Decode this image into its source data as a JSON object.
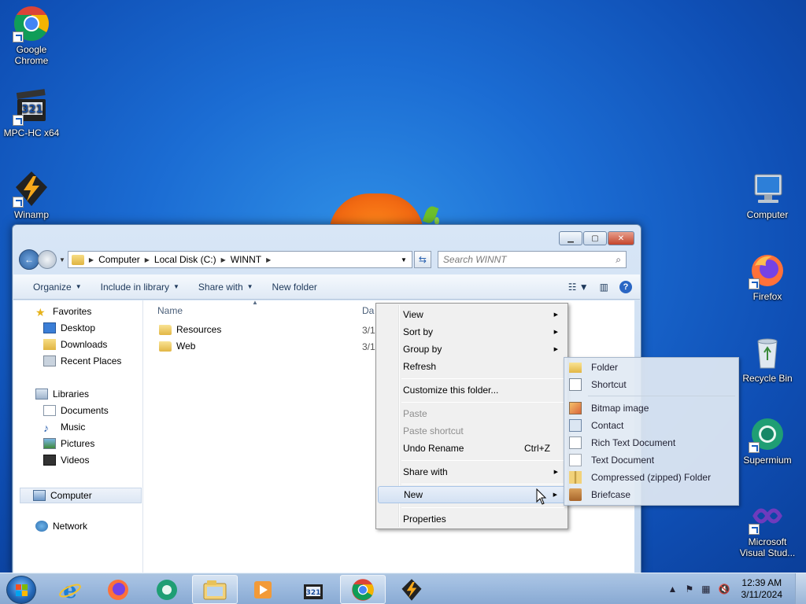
{
  "desktop": {
    "icons_left": [
      {
        "label": "Google Chrome",
        "icon": "chrome-icon"
      },
      {
        "label": "MPC-HC x64",
        "icon": "mpc-hc-icon"
      },
      {
        "label": "Winamp",
        "icon": "winamp-icon"
      }
    ],
    "icons_right": [
      {
        "label": "Computer",
        "icon": "computer-icon"
      },
      {
        "label": "Firefox",
        "icon": "firefox-icon"
      },
      {
        "label": "Recycle Bin",
        "icon": "recycle-bin-icon"
      },
      {
        "label": "Supermium",
        "icon": "supermium-icon"
      },
      {
        "label": "Microsoft Visual Stud...",
        "icon": "visual-studio-icon"
      }
    ]
  },
  "explorer": {
    "breadcrumb": [
      "Computer",
      "Local Disk (C:)",
      "WINNT"
    ],
    "search_placeholder": "Search WINNT",
    "toolbar": {
      "organize": "Organize",
      "include_in_library": "Include in library",
      "share_with": "Share with",
      "new_folder": "New folder"
    },
    "nav": {
      "favorites": "Favorites",
      "desktop": "Desktop",
      "downloads": "Downloads",
      "recent_places": "Recent Places",
      "libraries": "Libraries",
      "documents": "Documents",
      "music": "Music",
      "pictures": "Pictures",
      "videos": "Videos",
      "computer": "Computer",
      "network": "Network"
    },
    "columns": {
      "name": "Name",
      "date_partial": "Da"
    },
    "files": [
      {
        "name": "Resources",
        "date_partial": "3/1"
      },
      {
        "name": "Web",
        "date_partial": "3/1"
      }
    ]
  },
  "context_menu": {
    "view": "View",
    "sort_by": "Sort by",
    "group_by": "Group by",
    "refresh": "Refresh",
    "customize": "Customize this folder...",
    "paste": "Paste",
    "paste_shortcut": "Paste shortcut",
    "undo_rename": "Undo Rename",
    "undo_accel": "Ctrl+Z",
    "share_with": "Share with",
    "new": "New",
    "properties": "Properties"
  },
  "new_submenu": {
    "folder": "Folder",
    "shortcut": "Shortcut",
    "bitmap": "Bitmap image",
    "contact": "Contact",
    "rtf": "Rich Text Document",
    "text": "Text Document",
    "zip": "Compressed (zipped) Folder",
    "briefcase": "Briefcase"
  },
  "taskbar": {
    "apps": [
      "internet-explorer-icon",
      "firefox-icon",
      "supermium-icon",
      "file-explorer-icon",
      "media-player-icon",
      "mpc-hc-icon",
      "chrome-icon",
      "winamp-icon"
    ],
    "active": [
      "file-explorer-icon",
      "chrome-icon"
    ],
    "clock_time": "12:39 AM",
    "clock_date": "3/11/2024"
  },
  "colors": {
    "desktop_bg": "#1b6cd3",
    "window_frame": "#c3d7ef",
    "menu_bg": "#f0f0f0",
    "submenu_bg": "#e1e9f3"
  }
}
